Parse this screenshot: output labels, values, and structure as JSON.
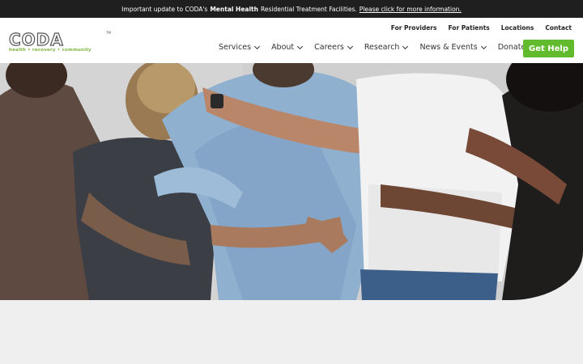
{
  "announcement": {
    "prefix": "Important update to CODA's",
    "bold": "Mental Health",
    "suffix": "Residential Treatment Facilities.",
    "link": "Please click for more information."
  },
  "logo": {
    "word": "CODA",
    "tm": "TM",
    "tagline": "health • recovery • community"
  },
  "utility_nav": [
    "For Providers",
    "For Patients",
    "Locations",
    "Contact"
  ],
  "main_nav": {
    "services": "Services",
    "about": "About",
    "careers": "Careers",
    "research": "Research",
    "news": "News & Events",
    "donate": "Donate"
  },
  "cta": "Get Help",
  "colors": {
    "accent": "#62bb2d",
    "topbar": "#1f1f1f",
    "logo_green": "#7cb43b"
  },
  "hero_image": "group-of-people-arms-around-each-other"
}
